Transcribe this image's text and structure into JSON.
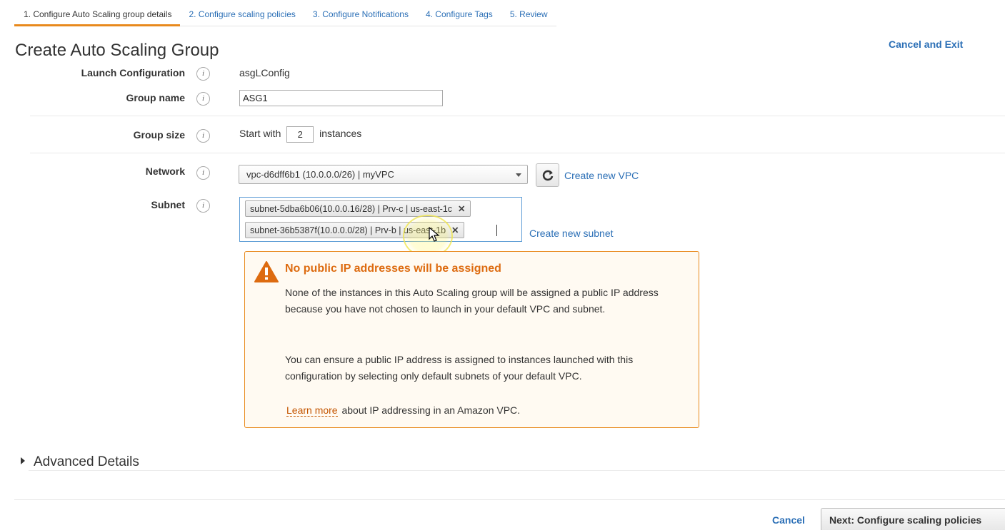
{
  "tabs": [
    {
      "label": "1. Configure Auto Scaling group details"
    },
    {
      "label": "2. Configure scaling policies"
    },
    {
      "label": "3. Configure Notifications"
    },
    {
      "label": "4. Configure Tags"
    },
    {
      "label": "5. Review"
    }
  ],
  "header": {
    "title": "Create Auto Scaling Group",
    "cancel_exit": "Cancel and Exit"
  },
  "form": {
    "launch_config": {
      "label": "Launch Configuration",
      "value": "asgLConfig"
    },
    "group_name": {
      "label": "Group name",
      "value": "ASG1"
    },
    "group_size": {
      "label": "Group size",
      "prefix": "Start with",
      "value": "2",
      "suffix": "instances"
    },
    "network": {
      "label": "Network",
      "value": "vpc-d6dff6b1 (10.0.0.0/26) | myVPC",
      "create_link": "Create new VPC"
    },
    "subnet": {
      "label": "Subnet",
      "selected": [
        "subnet-5dba6b06(10.0.0.16/28) | Prv-c | us-east-1c",
        "subnet-36b5387f(10.0.0.0/28) | Prv-b | us-east-1b"
      ],
      "create_link": "Create new subnet"
    },
    "info_glyph": "i"
  },
  "warning": {
    "title": "No public IP addresses will be assigned",
    "p1": "None of the instances in this Auto Scaling group will be assigned a public IP address because you have not chosen to launch in your default VPC and subnet.",
    "p2": "You can ensure a public IP address is assigned to instances launched with this configuration by selecting only default subnets of your default VPC.",
    "learn_more": "Learn more",
    "p3_tail": "about IP addressing in an Amazon VPC.",
    "icon": "warning-triangle-icon",
    "color": "#e8891c"
  },
  "advanced": {
    "label": "Advanced Details"
  },
  "footer": {
    "cancel": "Cancel",
    "next": "Next: Configure scaling policies"
  },
  "colors": {
    "accent": "#e8891c",
    "link": "#2b6fb6",
    "warning_text": "#dd6b10"
  }
}
